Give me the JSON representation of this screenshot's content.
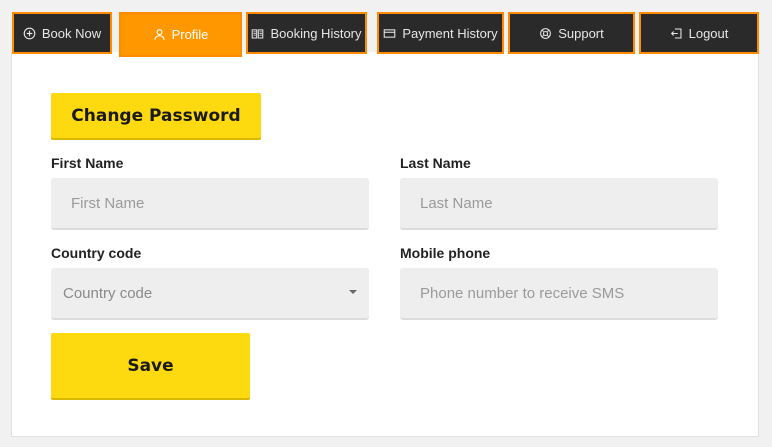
{
  "nav": {
    "tabs": [
      {
        "label": "Book Now",
        "icon": "plus-circle-icon"
      },
      {
        "label": "Profile",
        "icon": "user-icon"
      },
      {
        "label": "Booking History",
        "icon": "book-icon"
      },
      {
        "label": "Payment History",
        "icon": "card-icon"
      },
      {
        "label": "Support",
        "icon": "support-icon"
      },
      {
        "label": "Logout",
        "icon": "logout-icon"
      }
    ],
    "active_index": 1
  },
  "profile": {
    "change_password_label": "Change Password",
    "first_name": {
      "label": "First Name",
      "placeholder": "First Name",
      "value": ""
    },
    "last_name": {
      "label": "Last Name",
      "placeholder": "Last Name",
      "value": ""
    },
    "country_code": {
      "label": "Country code",
      "placeholder": "Country code"
    },
    "mobile_phone": {
      "label": "Mobile phone",
      "placeholder": "Phone number to receive SMS",
      "value": ""
    },
    "save_label": "Save"
  },
  "colors": {
    "accent": "#ff9800",
    "tab_bg": "#2a2a2a",
    "button_yellow": "#fdd90f",
    "field_bg": "#eeeeee"
  }
}
